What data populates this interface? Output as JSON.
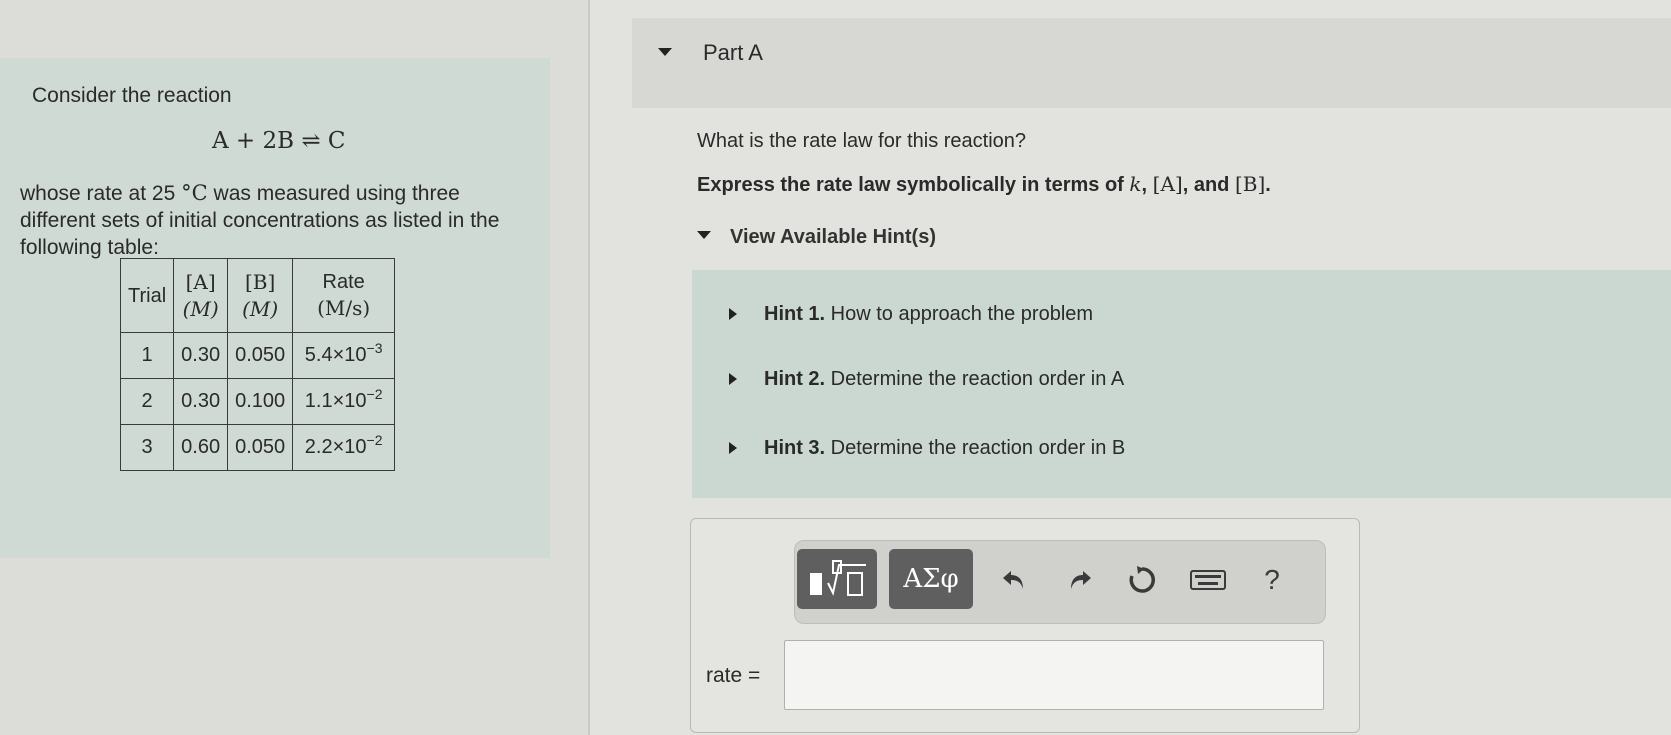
{
  "problem": {
    "intro": "Consider the reaction",
    "reaction": "A + 2B ⇌ C",
    "description_pre": "whose rate at 25 ",
    "description_unit": "°C",
    "description_post": " was measured using three different sets of initial concentrations as listed in the following table:"
  },
  "table": {
    "headers": {
      "trial": "Trial",
      "a_top": "[A]",
      "a_bottom": "(M)",
      "b_top": "[B]",
      "b_bottom": "(M)",
      "rate_top": "Rate",
      "rate_bottom": "(M/s)"
    },
    "rows": [
      {
        "trial": "1",
        "a": "0.30",
        "b": "0.050",
        "rate_base": "5.4×10",
        "rate_exp": "−3"
      },
      {
        "trial": "2",
        "a": "0.30",
        "b": "0.100",
        "rate_base": "1.1×10",
        "rate_exp": "−2"
      },
      {
        "trial": "3",
        "a": "0.60",
        "b": "0.050",
        "rate_base": "2.2×10",
        "rate_exp": "−2"
      }
    ]
  },
  "part": {
    "label": "Part A",
    "question": "What is the rate law for this reaction?",
    "express_pre": "Express the rate law symbolically in terms of ",
    "express_k": "k",
    "express_sep1": ", ",
    "express_a": "[A]",
    "express_sep2": ", and ",
    "express_b": "[B]",
    "express_end": "."
  },
  "hints": {
    "toggle_label": "View Available Hint(s)",
    "items": [
      {
        "number": "Hint 1.",
        "text": " How to approach the problem"
      },
      {
        "number": "Hint 2.",
        "text": " Determine the reaction order in A"
      },
      {
        "number": "Hint 3.",
        "text": " Determine the reaction order in B"
      }
    ]
  },
  "toolbar": {
    "greek_label": "ΑΣφ",
    "help_label": "?"
  },
  "answer": {
    "label": "rate =",
    "value": ""
  }
}
